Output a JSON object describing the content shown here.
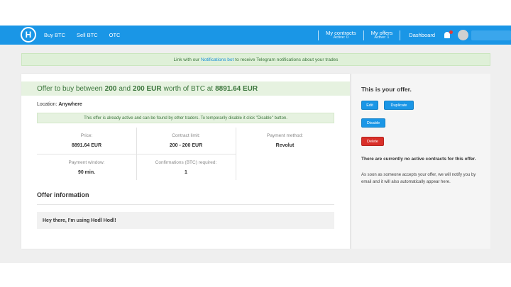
{
  "nav": {
    "logo_letter": "H",
    "links": [
      "Buy BTC",
      "Sell BTC",
      "OTC"
    ],
    "my_contracts": {
      "label": "My contracts",
      "sub": "Active: 0"
    },
    "my_offers": {
      "label": "My offers",
      "sub": "Active: 1"
    },
    "dashboard": "Dashboard"
  },
  "notification": {
    "prefix": "Link with our",
    "link": "Notifications bot",
    "suffix": "to receive Telegram notifications about your trades"
  },
  "offer": {
    "title_prefix": "Offer to buy between",
    "min": "200",
    "and": "and",
    "max": "200 EUR",
    "worth": "worth of BTC at",
    "price": "8891.64 EUR",
    "location_label": "Location:",
    "location_value": "Anywhere",
    "active_note": "This offer is already active and can be found by other traders. To temporarily disable it click \"Disable\" button.",
    "details": {
      "price_label": "Price:",
      "price_value": "8891.64 EUR",
      "limit_label": "Contract limit:",
      "limit_value": "200 - 200 EUR",
      "method_label": "Payment method:",
      "method_value": "Revolut",
      "window_label": "Payment window:",
      "window_value": "90 min.",
      "confirm_label": "Confirmations (BTC) required:",
      "confirm_value": "1"
    },
    "info_title": "Offer information",
    "info_text": "Hey there, I'm using Hodl Hodl!"
  },
  "sidebar": {
    "title": "This is your offer.",
    "edit": "Edit",
    "duplicate": "Duplicate",
    "disable": "Disable",
    "delete": "Delete",
    "no_contracts": "There are currently no active contracts for this offer.",
    "notice": "As soon as someone accepts your offer, we will notify you by email and it will also automatically appear here."
  },
  "colors": {
    "nav": "#1a96e6",
    "success_bg": "#dff0d8",
    "success_text": "#3c763d",
    "danger": "#d9302a"
  }
}
